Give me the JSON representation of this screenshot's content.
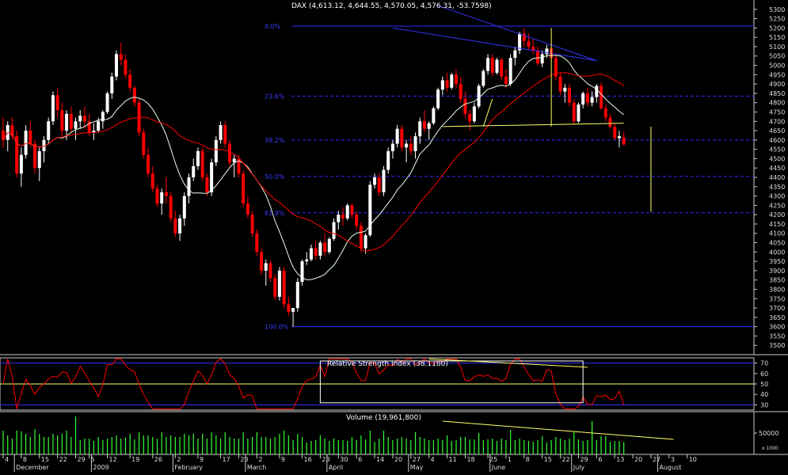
{
  "chart_data": [
    {
      "type": "candlestick",
      "title": "DAX (4,613.12, 4,644.55, 4,570.05, 4,576.31, -53.7598)",
      "ylim": [
        3450,
        5350
      ],
      "y_ticks": [
        3500,
        3550,
        3600,
        3650,
        3700,
        3750,
        3800,
        3850,
        3900,
        3950,
        4000,
        4050,
        4100,
        4150,
        4200,
        4250,
        4300,
        4350,
        4400,
        4450,
        4500,
        4550,
        4600,
        4650,
        4700,
        4750,
        4800,
        4850,
        4900,
        4950,
        5000,
        5050,
        5100,
        5150,
        5200,
        5250,
        5300
      ],
      "ohlc": [
        [
          4650,
          4720,
          4560,
          4600
        ],
        [
          4600,
          4700,
          4540,
          4680
        ],
        [
          4680,
          4720,
          4600,
          4620
        ],
        [
          4620,
          4650,
          4400,
          4420
        ],
        [
          4420,
          4560,
          4350,
          4520
        ],
        [
          4520,
          4680,
          4500,
          4650
        ],
        [
          4650,
          4700,
          4560,
          4580
        ],
        [
          4580,
          4600,
          4420,
          4450
        ],
        [
          4450,
          4560,
          4380,
          4540
        ],
        [
          4540,
          4620,
          4480,
          4600
        ],
        [
          4600,
          4720,
          4580,
          4700
        ],
        [
          4700,
          4860,
          4680,
          4840
        ],
        [
          4840,
          4880,
          4720,
          4760
        ],
        [
          4760,
          4800,
          4620,
          4650
        ],
        [
          4650,
          4760,
          4600,
          4740
        ],
        [
          4740,
          4780,
          4640,
          4660
        ],
        [
          4660,
          4720,
          4600,
          4700
        ],
        [
          4700,
          4760,
          4660,
          4730
        ],
        [
          4730,
          4780,
          4660,
          4700
        ],
        [
          4700,
          4740,
          4620,
          4640
        ],
        [
          4640,
          4690,
          4600,
          4650
        ],
        [
          4650,
          4720,
          4640,
          4700
        ],
        [
          4700,
          4760,
          4660,
          4750
        ],
        [
          4750,
          4860,
          4740,
          4850
        ],
        [
          4850,
          4960,
          4820,
          4940
        ],
        [
          4940,
          5080,
          4920,
          5060
        ],
        [
          5060,
          5120,
          5000,
          5030
        ],
        [
          5030,
          5060,
          4930,
          4950
        ],
        [
          4950,
          4980,
          4860,
          4880
        ],
        [
          4880,
          4890,
          4780,
          4800
        ],
        [
          4800,
          4820,
          4620,
          4640
        ],
        [
          4640,
          4660,
          4500,
          4520
        ],
        [
          4520,
          4560,
          4400,
          4420
        ],
        [
          4420,
          4460,
          4320,
          4340
        ],
        [
          4340,
          4360,
          4240,
          4260
        ],
        [
          4260,
          4340,
          4200,
          4320
        ],
        [
          4320,
          4400,
          4260,
          4300
        ],
        [
          4300,
          4320,
          4160,
          4180
        ],
        [
          4180,
          4220,
          4080,
          4100
        ],
        [
          4100,
          4200,
          4060,
          4180
        ],
        [
          4180,
          4320,
          4140,
          4300
        ],
        [
          4300,
          4420,
          4260,
          4400
        ],
        [
          4400,
          4500,
          4380,
          4460
        ],
        [
          4460,
          4560,
          4440,
          4540
        ],
        [
          4540,
          4560,
          4380,
          4400
        ],
        [
          4400,
          4420,
          4300,
          4320
        ],
        [
          4320,
          4500,
          4300,
          4480
        ],
        [
          4480,
          4620,
          4460,
          4600
        ],
        [
          4600,
          4700,
          4580,
          4680
        ],
        [
          4680,
          4700,
          4560,
          4580
        ],
        [
          4580,
          4600,
          4460,
          4480
        ],
        [
          4480,
          4520,
          4400,
          4500
        ],
        [
          4500,
          4520,
          4400,
          4420
        ],
        [
          4420,
          4440,
          4240,
          4260
        ],
        [
          4260,
          4300,
          4180,
          4200
        ],
        [
          4200,
          4220,
          4080,
          4100
        ],
        [
          4100,
          4120,
          3980,
          4000
        ],
        [
          4000,
          4020,
          3880,
          3900
        ],
        [
          3900,
          3960,
          3820,
          3940
        ],
        [
          3940,
          3960,
          3840,
          3860
        ],
        [
          3860,
          3880,
          3740,
          3760
        ],
        [
          3760,
          3920,
          3740,
          3900
        ],
        [
          3900,
          3920,
          3700,
          3720
        ],
        [
          3720,
          3760,
          3660,
          3680
        ],
        [
          3680,
          3700,
          3600,
          3700
        ],
        [
          3700,
          3860,
          3680,
          3840
        ],
        [
          3840,
          3960,
          3820,
          3950
        ],
        [
          3950,
          4000,
          3930,
          3960
        ],
        [
          3960,
          4040,
          3950,
          4020
        ],
        [
          4020,
          4060,
          3960,
          3980
        ],
        [
          3980,
          4060,
          3960,
          4050
        ],
        [
          4050,
          4100,
          3980,
          4000
        ],
        [
          4000,
          4080,
          3990,
          4070
        ],
        [
          4070,
          4180,
          4060,
          4160
        ],
        [
          4160,
          4220,
          4120,
          4200
        ],
        [
          4200,
          4240,
          4140,
          4180
        ],
        [
          4180,
          4260,
          4170,
          4250
        ],
        [
          4250,
          4260,
          4180,
          4200
        ],
        [
          4200,
          4220,
          4120,
          4140
        ],
        [
          4140,
          4160,
          4000,
          4020
        ],
        [
          4020,
          4100,
          3990,
          4090
        ],
        [
          4090,
          4380,
          4080,
          4360
        ],
        [
          4360,
          4420,
          4340,
          4400
        ],
        [
          4400,
          4420,
          4300,
          4320
        ],
        [
          4320,
          4460,
          4300,
          4440
        ],
        [
          4440,
          4560,
          4420,
          4540
        ],
        [
          4540,
          4600,
          4500,
          4580
        ],
        [
          4580,
          4680,
          4560,
          4660
        ],
        [
          4660,
          4680,
          4540,
          4560
        ],
        [
          4560,
          4600,
          4480,
          4580
        ],
        [
          4580,
          4620,
          4520,
          4540
        ],
        [
          4540,
          4640,
          4500,
          4620
        ],
        [
          4620,
          4720,
          4580,
          4700
        ],
        [
          4700,
          4760,
          4640,
          4660
        ],
        [
          4660,
          4700,
          4600,
          4690
        ],
        [
          4690,
          4780,
          4680,
          4770
        ],
        [
          4770,
          4880,
          4760,
          4870
        ],
        [
          4870,
          4940,
          4840,
          4920
        ],
        [
          4920,
          4960,
          4860,
          4880
        ],
        [
          4880,
          4960,
          4870,
          4950
        ],
        [
          4950,
          4980,
          4880,
          4900
        ],
        [
          4900,
          4940,
          4800,
          4820
        ],
        [
          4820,
          4860,
          4720,
          4740
        ],
        [
          4740,
          4760,
          4650,
          4700
        ],
        [
          4700,
          4800,
          4690,
          4780
        ],
        [
          4780,
          4900,
          4770,
          4890
        ],
        [
          4890,
          4980,
          4880,
          4970
        ],
        [
          4970,
          5060,
          4950,
          5040
        ],
        [
          5040,
          5060,
          4940,
          4960
        ],
        [
          4960,
          5040,
          4950,
          5030
        ],
        [
          5030,
          5040,
          4920,
          4940
        ],
        [
          4940,
          4980,
          4880,
          4900
        ],
        [
          4900,
          5060,
          4890,
          5040
        ],
        [
          5040,
          5100,
          5000,
          5080
        ],
        [
          5080,
          5180,
          5060,
          5170
        ],
        [
          5170,
          5200,
          5100,
          5130
        ],
        [
          5130,
          5170,
          5080,
          5100
        ],
        [
          5100,
          5140,
          5060,
          5080
        ],
        [
          5080,
          5100,
          5000,
          5010
        ],
        [
          5010,
          5080,
          4990,
          5060
        ],
        [
          5060,
          5110,
          5040,
          5090
        ],
        [
          5090,
          5120,
          5020,
          5040
        ],
        [
          5040,
          5060,
          4920,
          4940
        ],
        [
          4940,
          4960,
          4840,
          4860
        ],
        [
          4860,
          4900,
          4800,
          4880
        ],
        [
          4880,
          4900,
          4780,
          4800
        ],
        [
          4800,
          4820,
          4680,
          4700
        ],
        [
          4700,
          4800,
          4690,
          4790
        ],
        [
          4790,
          4860,
          4770,
          4850
        ],
        [
          4850,
          4880,
          4780,
          4800
        ],
        [
          4800,
          4860,
          4780,
          4830
        ],
        [
          4830,
          4900,
          4800,
          4890
        ],
        [
          4890,
          4910,
          4760,
          4770
        ],
        [
          4770,
          4790,
          4700,
          4720
        ],
        [
          4720,
          4740,
          4660,
          4670
        ],
        [
          4670,
          4690,
          4600,
          4610
        ],
        [
          4610,
          4650,
          4560,
          4620
        ],
        [
          4613.12,
          4644.55,
          4570.05,
          4576.31
        ]
      ],
      "series": [],
      "fib_levels": [
        {
          "label": "0.0%",
          "value": 5210
        },
        {
          "label": "23.6%",
          "value": 4835
        },
        {
          "label": "38.2%",
          "value": 4600
        },
        {
          "label": "50.0%",
          "value": 4405
        },
        {
          "label": "61.8%",
          "value": 4210
        },
        {
          "label": "100.0%",
          "value": 3600
        }
      ],
      "trend_lines": [
        {
          "from": [
            86,
            5200
          ],
          "to": [
            131,
            5025
          ]
        },
        {
          "from": [
            97,
            4672
          ],
          "to": [
            137,
            4690
          ]
        }
      ],
      "x_ticks": [
        {
          "i": 0,
          "label": "4"
        },
        {
          "i": 4,
          "label": "8"
        },
        {
          "i": 8,
          "label": "15"
        },
        {
          "i": 12,
          "label": "22"
        },
        {
          "i": 16,
          "label": "29"
        },
        {
          "i": 19,
          "label": "5"
        },
        {
          "i": 23,
          "label": "12"
        },
        {
          "i": 28,
          "label": "19"
        },
        {
          "i": 33,
          "label": "26"
        },
        {
          "i": 38,
          "label": "2"
        },
        {
          "i": 43,
          "label": "9"
        },
        {
          "i": 48,
          "label": "17"
        },
        {
          "i": 52,
          "label": "23"
        },
        {
          "i": 56,
          "label": "2"
        },
        {
          "i": 61,
          "label": "9"
        },
        {
          "i": 66,
          "label": "16"
        },
        {
          "i": 70,
          "label": "23"
        },
        {
          "i": 74,
          "label": "30"
        },
        {
          "i": 78,
          "label": "6"
        },
        {
          "i": 82,
          "label": "14"
        },
        {
          "i": 86,
          "label": "20"
        },
        {
          "i": 90,
          "label": "27"
        },
        {
          "i": 94,
          "label": "4"
        },
        {
          "i": 98,
          "label": "11"
        },
        {
          "i": 102,
          "label": "18"
        },
        {
          "i": 107,
          "label": "25"
        },
        {
          "i": 111,
          "label": "1"
        },
        {
          "i": 115,
          "label": "8"
        },
        {
          "i": 119,
          "label": "15"
        },
        {
          "i": 123,
          "label": "22"
        },
        {
          "i": 127,
          "label": "29"
        },
        {
          "i": 131,
          "label": "6"
        },
        {
          "i": 135,
          "label": "13"
        },
        {
          "i": 139,
          "label": "20"
        },
        {
          "i": 143,
          "label": "27"
        },
        {
          "i": 147,
          "label": "3"
        },
        {
          "i": 151,
          "label": "10"
        }
      ],
      "month_labels": [
        {
          "i": 3,
          "label": "December"
        },
        {
          "i": 20,
          "label": "2009"
        },
        {
          "i": 38,
          "label": "February"
        },
        {
          "i": 54,
          "label": "March"
        },
        {
          "i": 72,
          "label": "April"
        },
        {
          "i": 90,
          "label": "May"
        },
        {
          "i": 108,
          "label": "June"
        },
        {
          "i": 126,
          "label": "July"
        },
        {
          "i": 145,
          "label": "August"
        }
      ]
    },
    {
      "type": "line",
      "title": "Relative Strength Index (38.1180)",
      "ylim": [
        25,
        75
      ],
      "y_ticks": [
        30,
        40,
        50,
        60,
        70
      ],
      "ref_lines": [
        70,
        50,
        30
      ]
    },
    {
      "type": "bar",
      "title": "Volume (19,961,800)",
      "y_ticks": [
        {
          "value": 50000,
          "label": "50000"
        }
      ],
      "unit_label": "x 1000"
    }
  ]
}
